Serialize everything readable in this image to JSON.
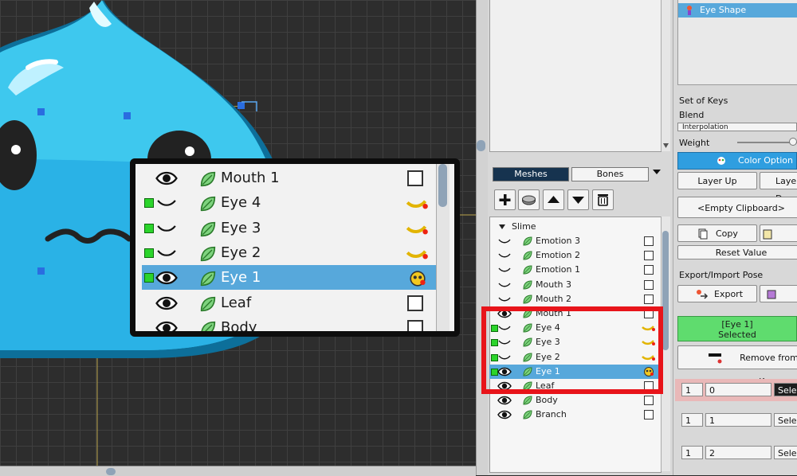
{
  "colors": {
    "selected_row": "#57a8db",
    "tab_active": "#16334f",
    "color_option": "#2f9ee0",
    "selected_box": "#5fdc6e",
    "highlight": "#e8141a",
    "grid": "#2d2d2d"
  },
  "tabs": {
    "meshes": "Meshes",
    "bones": "Bones",
    "dropdown_icon": "triangle-down-icon"
  },
  "toolbar": {
    "icons": [
      "plus-icon",
      "mesh-icon",
      "move-up-icon",
      "move-down-icon",
      "trash-icon"
    ]
  },
  "hierarchy": {
    "root": "Slime",
    "rows": [
      {
        "label": "Emotion 3",
        "vis": "closed",
        "selected": false,
        "key": false,
        "square": false
      },
      {
        "label": "Emotion 2",
        "vis": "closed",
        "selected": false,
        "key": false,
        "square": false
      },
      {
        "label": "Emotion 1",
        "vis": "closed",
        "selected": false,
        "key": false,
        "square": false
      },
      {
        "label": "Mouth 3",
        "vis": "closed",
        "selected": false,
        "key": false,
        "square": false
      },
      {
        "label": "Mouth 2",
        "vis": "closed",
        "selected": false,
        "key": false,
        "square": false
      },
      {
        "label": "Mouth 1",
        "vis": "open",
        "selected": false,
        "key": false,
        "square": false
      },
      {
        "label": "Eye 4",
        "vis": "closed",
        "selected": false,
        "key": true,
        "square": true
      },
      {
        "label": "Eye 3",
        "vis": "closed",
        "selected": false,
        "key": true,
        "square": true
      },
      {
        "label": "Eye 2",
        "vis": "closed",
        "selected": false,
        "key": true,
        "square": true
      },
      {
        "label": "Eye 1",
        "vis": "open",
        "selected": true,
        "key": true,
        "square": true
      },
      {
        "label": "Leaf",
        "vis": "open",
        "selected": false,
        "key": false,
        "square": false
      },
      {
        "label": "Body",
        "vis": "open",
        "selected": false,
        "key": false,
        "square": false
      },
      {
        "label": "Branch",
        "vis": "open",
        "selected": false,
        "key": false,
        "square": false
      }
    ]
  },
  "inset": {
    "rows": [
      {
        "label": "Mouth 1",
        "vis": "open",
        "selected": false,
        "key": false,
        "square": false
      },
      {
        "label": "Eye 4",
        "vis": "closed",
        "selected": false,
        "key": true,
        "square": true
      },
      {
        "label": "Eye 3",
        "vis": "closed",
        "selected": false,
        "key": true,
        "square": true
      },
      {
        "label": "Eye 2",
        "vis": "closed",
        "selected": false,
        "key": true,
        "square": true
      },
      {
        "label": "Eye 1",
        "vis": "open",
        "selected": true,
        "key": true,
        "square": true
      },
      {
        "label": "Leaf",
        "vis": "open",
        "selected": false,
        "key": false,
        "square": false
      },
      {
        "label": "Body",
        "vis": "open",
        "selected": false,
        "key": false,
        "square": false
      }
    ]
  },
  "right": {
    "eye_shape": "Eye Shape",
    "set_of_keys": "Set of Keys",
    "blend": "Blend",
    "interpolation": "Interpolation",
    "weight": "Weight",
    "color_option": "Color Option On",
    "layer_up": "Layer Up",
    "layer_down": "Layer Down",
    "empty_clipboard": "<Empty Clipboard>",
    "copy": "Copy",
    "paste": "Paste",
    "reset_value": "Reset Value",
    "export_import_pose": "Export/Import Pose",
    "export": "Export",
    "import": "Import",
    "selected_line1": "[Eye 1]",
    "selected_line2": "Selected",
    "remove_from_keys": "Remove from Keys",
    "num_rows": [
      {
        "index": "1",
        "value": "0",
        "button": "Select"
      },
      {
        "index": "1",
        "value": "1",
        "button": "Select"
      },
      {
        "index": "1",
        "value": "2",
        "button": "Select"
      }
    ]
  }
}
